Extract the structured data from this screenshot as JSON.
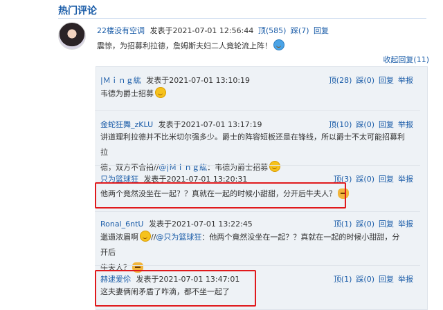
{
  "section_title": "热门评论",
  "main_comment": {
    "user": "22楼没有空调",
    "posted": "发表于2021-07-01 12:56:44",
    "up": "顶(585)",
    "down": "踩(7)",
    "reply": "回复",
    "text": "震惊，为招募利拉德，詹姆斯夫妇二人竟轮流上阵！"
  },
  "collapse_label": "收起回复(11)",
  "replies": [
    {
      "user": "|Ｍｉｎｇ紘",
      "posted": "发表于2021-07-01 13:10:19",
      "up": "顶(28)",
      "down": "踩(0)",
      "reply": "回复",
      "report": "举报",
      "text": "韦德为爵士招募"
    },
    {
      "user": "金蛇狂舞_zKLU",
      "posted": "发表于2021-07-01 13:17:19",
      "up": "顶(10)",
      "down": "踩(0)",
      "reply": "回复",
      "report": "举报",
      "text_line1": "讲道理利拉德并不比米切尔强多少。爵士的阵容短板还是在锋线，所以爵士不太可能招募利拉",
      "text_line2_pre": "德，双方不合拍//",
      "text_line2_link": "@|Ｍｉｎｇ紘",
      "text_line2_post": "：韦德为爵士招募"
    },
    {
      "user": "只为篮球狂",
      "posted": "发表于2021-07-01 13:20:31",
      "up": "顶(3)",
      "down": "踩(0)",
      "reply": "回复",
      "report": "举报",
      "text": "他两个竟然没坐在一起？？真就在一起的时候小甜甜，分开后牛夫人？"
    },
    {
      "user": "Ronal_6ntU",
      "posted": "发表于2021-07-01 13:22:45",
      "up": "顶(1)",
      "down": "踩(0)",
      "reply": "回复",
      "report": "举报",
      "text_line1_pre": "邋遢浓眉啊",
      "text_line1_mid": "//",
      "text_line1_link": "@只为篮球狂",
      "text_line1_post": "：他两个竟然没坐在一起？？真就在一起的时候小甜甜，分开后",
      "text_line2": "牛夫人？"
    },
    {
      "user": "赫逮爱伱",
      "posted": "发表于2021-07-01 13:47:01",
      "up": "顶(1)",
      "down": "踩(0)",
      "reply": "回复",
      "report": "举报",
      "text": "这夫妻俩闹矛盾了咋滴，都不坐一起了"
    }
  ],
  "colors": {
    "link": "#1a5ca8",
    "highlight": "#e0191c",
    "panel": "#eef2f6"
  }
}
